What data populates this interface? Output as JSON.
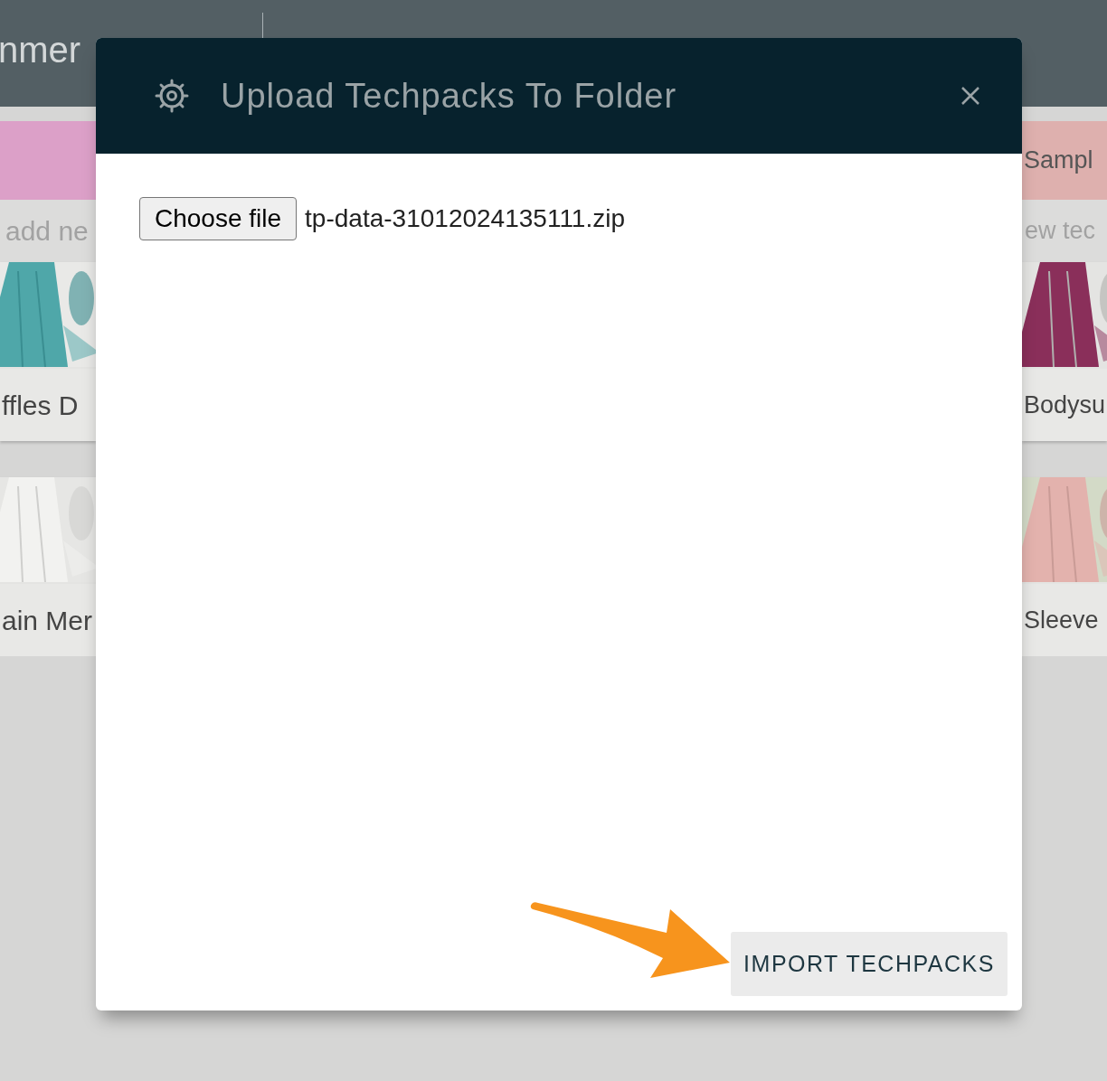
{
  "top_bar": {
    "title": "nmer"
  },
  "columns": [
    {
      "color": "#dca0c8",
      "placeholder": "add ne",
      "cards": [
        {
          "title": "ffles D"
        },
        {
          "title": "ain Mer"
        }
      ]
    },
    {
      "color": "#deb0ae",
      "header": "Sampl",
      "placeholder": "ew tec",
      "cards": [
        {
          "title": "Bodysu"
        },
        {
          "title": "Sleeve"
        }
      ]
    }
  ],
  "dialog": {
    "title": "Upload Techpacks To Folder",
    "file_button": "Choose file",
    "file_name": "tp-data-31012024135111.zip",
    "submit_button": "IMPORT TECHPACKS"
  }
}
